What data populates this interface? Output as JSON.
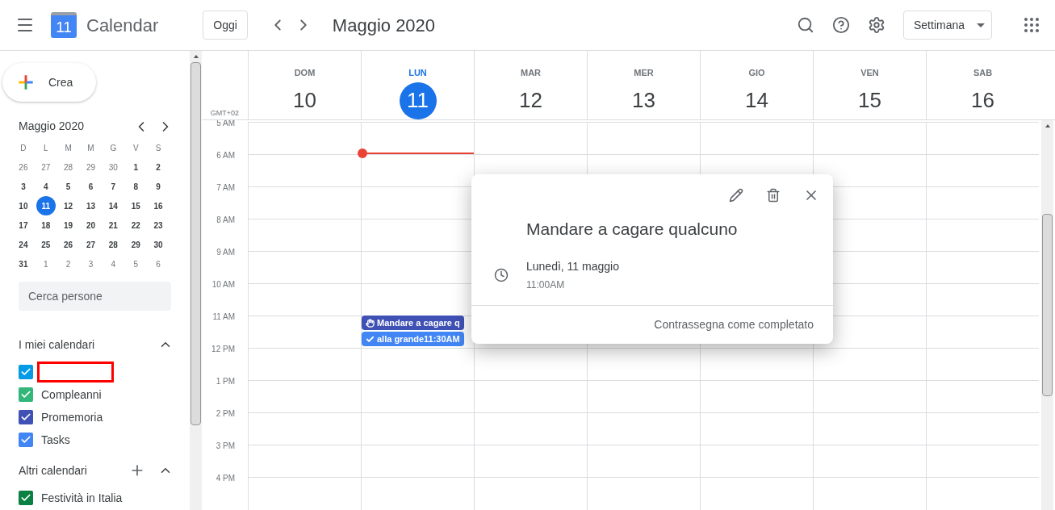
{
  "header": {
    "app_name": "Calendar",
    "logo_day": "11",
    "today_button": "Oggi",
    "period": "Maggio 2020",
    "view_select": "Settimana"
  },
  "sidebar": {
    "create_button": "Crea",
    "mini_calendar": {
      "title": "Maggio 2020",
      "weekdays": [
        "D",
        "L",
        "M",
        "M",
        "G",
        "V",
        "S"
      ],
      "weeks": [
        [
          {
            "d": "26",
            "muted": true,
            "selected": false
          },
          {
            "d": "27",
            "muted": true,
            "selected": false
          },
          {
            "d": "28",
            "muted": true,
            "selected": false
          },
          {
            "d": "29",
            "muted": true,
            "selected": false
          },
          {
            "d": "30",
            "muted": true,
            "selected": false
          },
          {
            "d": "1",
            "muted": false,
            "selected": false
          },
          {
            "d": "2",
            "muted": false,
            "selected": false
          }
        ],
        [
          {
            "d": "3",
            "muted": false,
            "selected": false
          },
          {
            "d": "4",
            "muted": false,
            "selected": false
          },
          {
            "d": "5",
            "muted": false,
            "selected": false
          },
          {
            "d": "6",
            "muted": false,
            "selected": false
          },
          {
            "d": "7",
            "muted": false,
            "selected": false
          },
          {
            "d": "8",
            "muted": false,
            "selected": false
          },
          {
            "d": "9",
            "muted": false,
            "selected": false
          }
        ],
        [
          {
            "d": "10",
            "muted": false,
            "selected": false
          },
          {
            "d": "11",
            "muted": false,
            "selected": true
          },
          {
            "d": "12",
            "muted": false,
            "selected": false
          },
          {
            "d": "13",
            "muted": false,
            "selected": false
          },
          {
            "d": "14",
            "muted": false,
            "selected": false
          },
          {
            "d": "15",
            "muted": false,
            "selected": false
          },
          {
            "d": "16",
            "muted": false,
            "selected": false
          }
        ],
        [
          {
            "d": "17",
            "muted": false,
            "selected": false
          },
          {
            "d": "18",
            "muted": false,
            "selected": false
          },
          {
            "d": "19",
            "muted": false,
            "selected": false
          },
          {
            "d": "20",
            "muted": false,
            "selected": false
          },
          {
            "d": "21",
            "muted": false,
            "selected": false
          },
          {
            "d": "22",
            "muted": false,
            "selected": false
          },
          {
            "d": "23",
            "muted": false,
            "selected": false
          }
        ],
        [
          {
            "d": "24",
            "muted": false,
            "selected": false
          },
          {
            "d": "25",
            "muted": false,
            "selected": false
          },
          {
            "d": "26",
            "muted": false,
            "selected": false
          },
          {
            "d": "27",
            "muted": false,
            "selected": false
          },
          {
            "d": "28",
            "muted": false,
            "selected": false
          },
          {
            "d": "29",
            "muted": false,
            "selected": false
          },
          {
            "d": "30",
            "muted": false,
            "selected": false
          }
        ],
        [
          {
            "d": "31",
            "muted": false,
            "selected": false
          },
          {
            "d": "1",
            "muted": true,
            "selected": false
          },
          {
            "d": "2",
            "muted": true,
            "selected": false
          },
          {
            "d": "3",
            "muted": true,
            "selected": false
          },
          {
            "d": "4",
            "muted": true,
            "selected": false
          },
          {
            "d": "5",
            "muted": true,
            "selected": false
          },
          {
            "d": "6",
            "muted": true,
            "selected": false
          }
        ]
      ]
    },
    "search": {
      "placeholder": "Cerca persone"
    },
    "my_calendars": {
      "title": "I miei calendari",
      "expanded": true,
      "items": [
        {
          "redacted": true,
          "checked": true,
          "color": "#039be5"
        },
        {
          "label": "Compleanni",
          "redacted": false,
          "checked": true,
          "color": "#33b679"
        },
        {
          "label": "Promemoria",
          "redacted": false,
          "checked": true,
          "color": "#3f51b5"
        },
        {
          "label": "Tasks",
          "redacted": false,
          "checked": true,
          "color": "#4285f4"
        }
      ]
    },
    "other_calendars": {
      "title": "Altri calendari",
      "expanded": true,
      "items": [
        {
          "label": "Festività in Italia",
          "redacted": false,
          "checked": true,
          "color": "#0b8043"
        }
      ]
    }
  },
  "week": {
    "timezone": "GMT+02",
    "days": [
      {
        "name": "DOM",
        "number": "10",
        "selected": false
      },
      {
        "name": "LUN",
        "number": "11",
        "selected": true,
        "now_line": true,
        "events": [
          {
            "kind": "reminder",
            "title": "Mandare a cagare q",
            "color": "#3f51b5"
          },
          {
            "kind": "task",
            "title": "alla grande11:30AM",
            "color": "#4285f4"
          }
        ]
      },
      {
        "name": "MAR",
        "number": "12",
        "selected": false
      },
      {
        "name": "MER",
        "number": "13",
        "selected": false
      },
      {
        "name": "GIO",
        "number": "14",
        "selected": false
      },
      {
        "name": "VEN",
        "number": "15",
        "selected": false
      },
      {
        "name": "SAB",
        "number": "16",
        "selected": false
      }
    ],
    "hours": [
      "5 AM",
      "6 AM",
      "7 AM",
      "8 AM",
      "9 AM",
      "10 AM",
      "11 AM",
      "12 PM",
      "1 PM",
      "2 PM",
      "3 PM",
      "4 PM"
    ]
  },
  "popup": {
    "title": "Mandare a cagare qualcuno",
    "date": "Lunedì, 11 maggio",
    "time": "11:00AM",
    "action": "Contrassegna come completato"
  }
}
